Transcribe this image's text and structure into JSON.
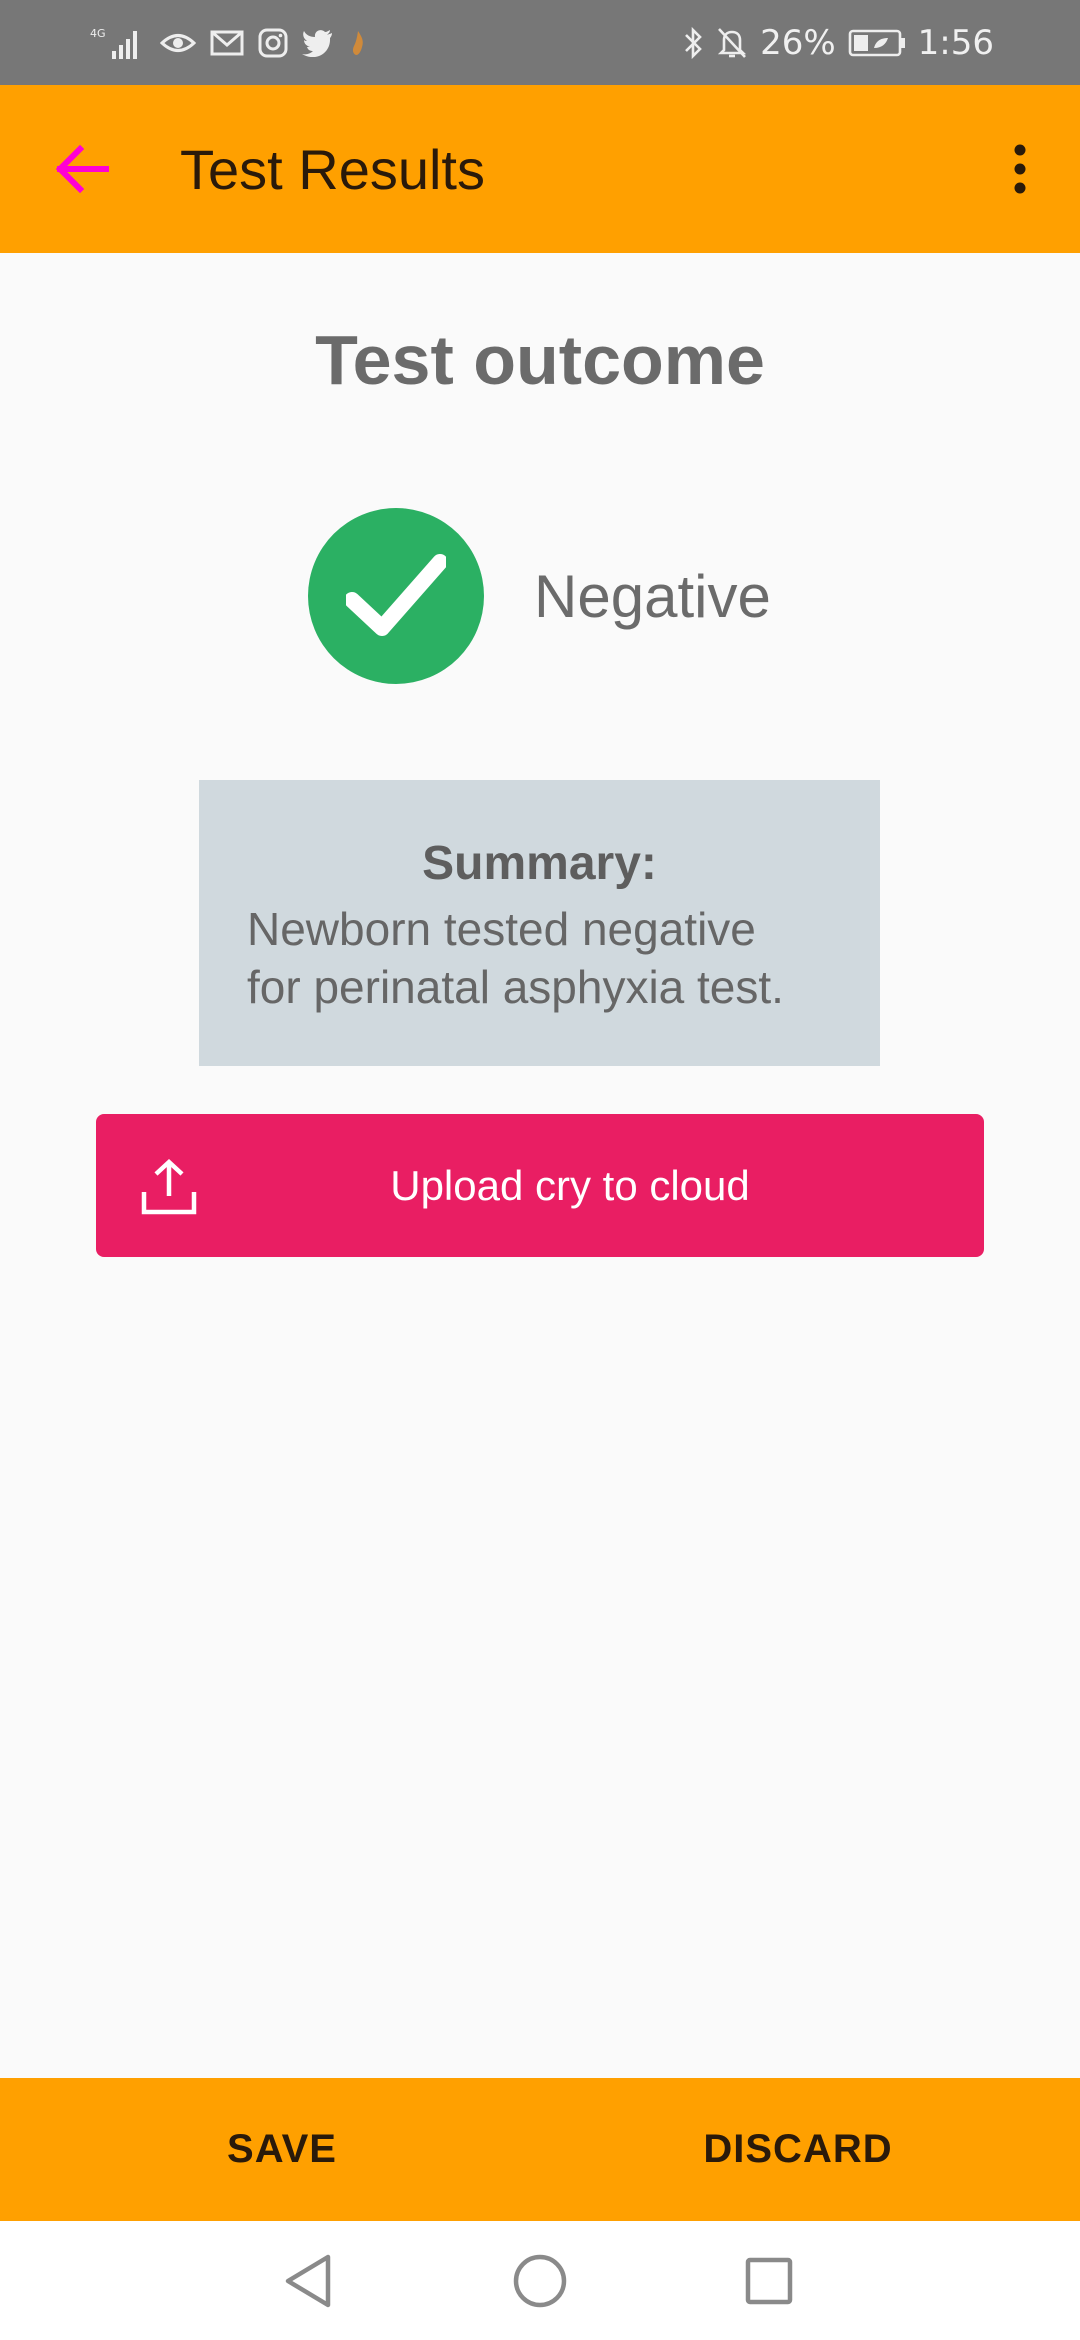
{
  "status_bar": {
    "network": "4G",
    "battery": "26%",
    "time": "1:56",
    "icons": [
      "signal-icon",
      "eye-icon",
      "gmail-icon",
      "instagram-icon",
      "twitter-icon",
      "flame-icon",
      "bluetooth-icon",
      "bell-off-icon",
      "battery-icon"
    ]
  },
  "app_bar": {
    "title": "Test Results",
    "back_icon": "arrow-back-icon",
    "menu_icon": "more-vert-icon",
    "accent": "#ffa000",
    "back_color": "#ff00d4"
  },
  "main": {
    "heading": "Test outcome",
    "result": {
      "label": "Negative",
      "icon": "check-icon",
      "color": "#2bb063"
    },
    "summary": {
      "heading": "Summary:",
      "line1": "Newborn tested negative",
      "line2": "for perinatal asphyxia test."
    },
    "upload_button": {
      "label": "Upload cry to cloud",
      "icon": "upload-icon",
      "color": "#e91e63"
    }
  },
  "bottom_bar": {
    "save_label": "SAVE",
    "discard_label": "DISCARD"
  },
  "nav_bar": {
    "back_icon": "nav-back-icon",
    "home_icon": "nav-home-icon",
    "recents_icon": "nav-recents-icon"
  }
}
